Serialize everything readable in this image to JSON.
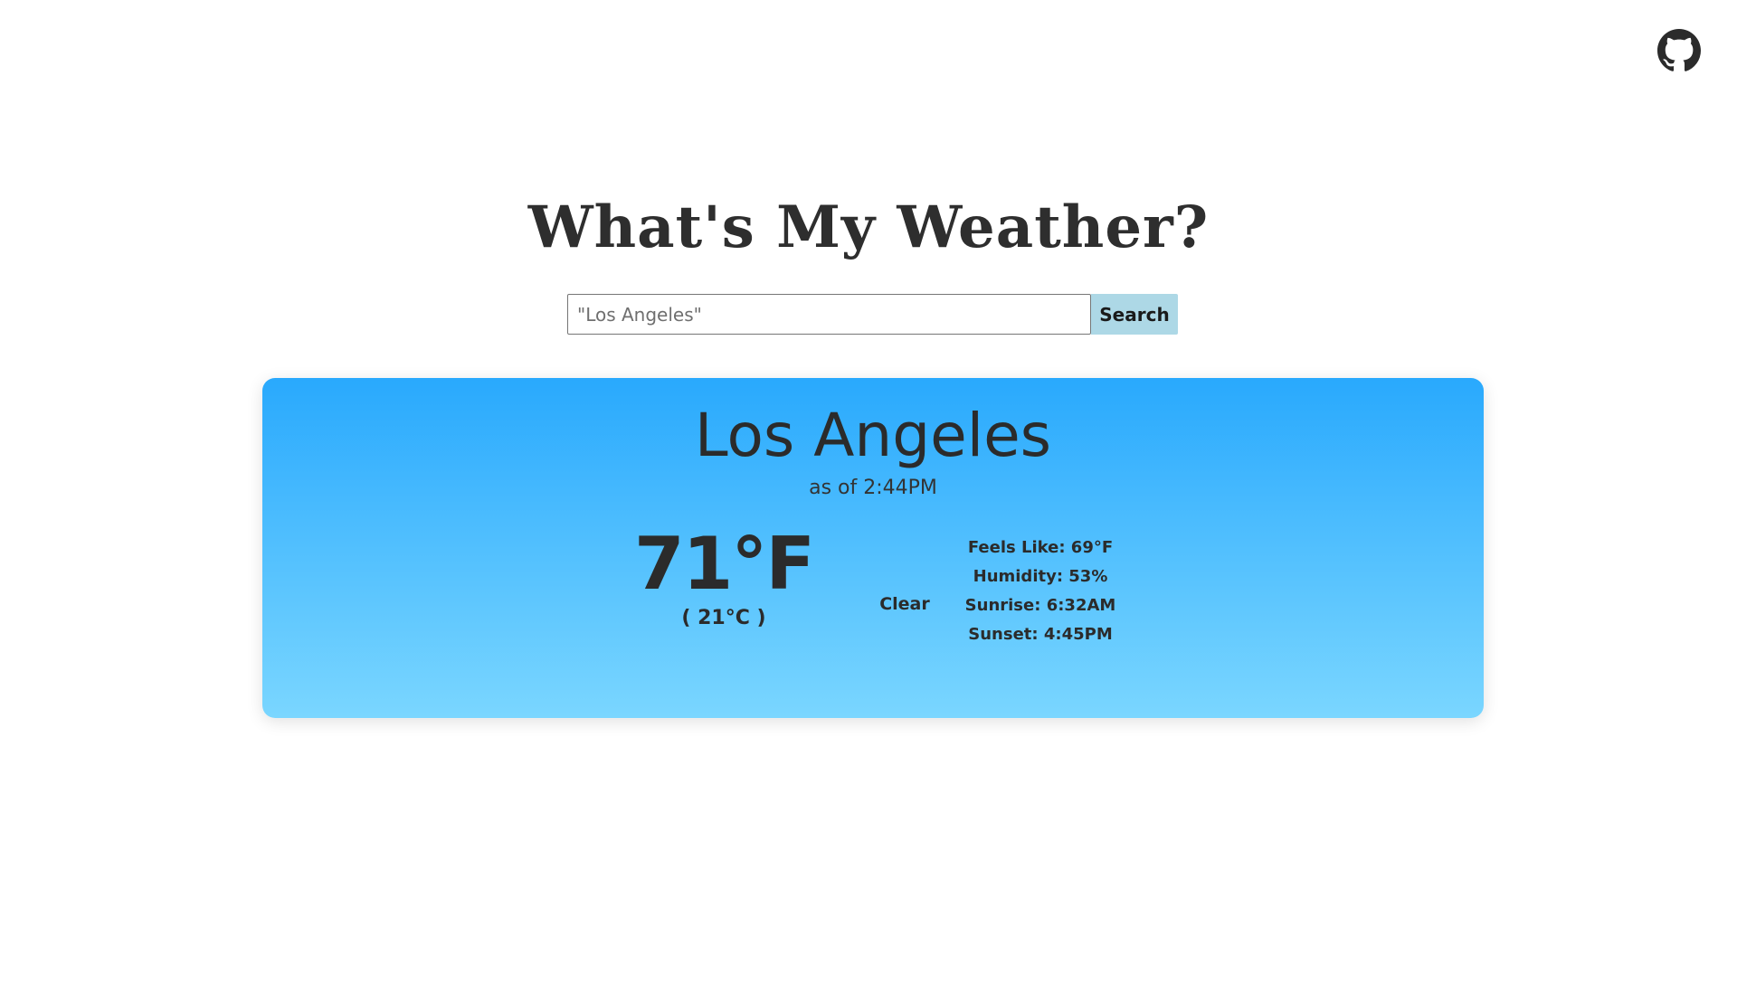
{
  "header": {
    "title": "What's My Weather?",
    "github_icon": "github-icon"
  },
  "search": {
    "placeholder": "\"Los Angeles\"",
    "value": "",
    "button_label": "Search"
  },
  "weather": {
    "city": "Los Angeles",
    "as_of": "as of 2:44PM",
    "temp_f": "71°F",
    "temp_c": "( 21°C )",
    "condition": "Clear",
    "details": [
      {
        "label": "Feels Like: 69°F"
      },
      {
        "label": "Humidity: 53%"
      },
      {
        "label": "Sunrise: 6:32AM"
      },
      {
        "label": "Sunset: 4:45PM"
      }
    ]
  },
  "colors": {
    "card_gradient_top": "#29a9fd",
    "card_gradient_bottom": "#7ad6ff",
    "search_button_bg": "#add8e6",
    "text": "#2b2b2b"
  }
}
